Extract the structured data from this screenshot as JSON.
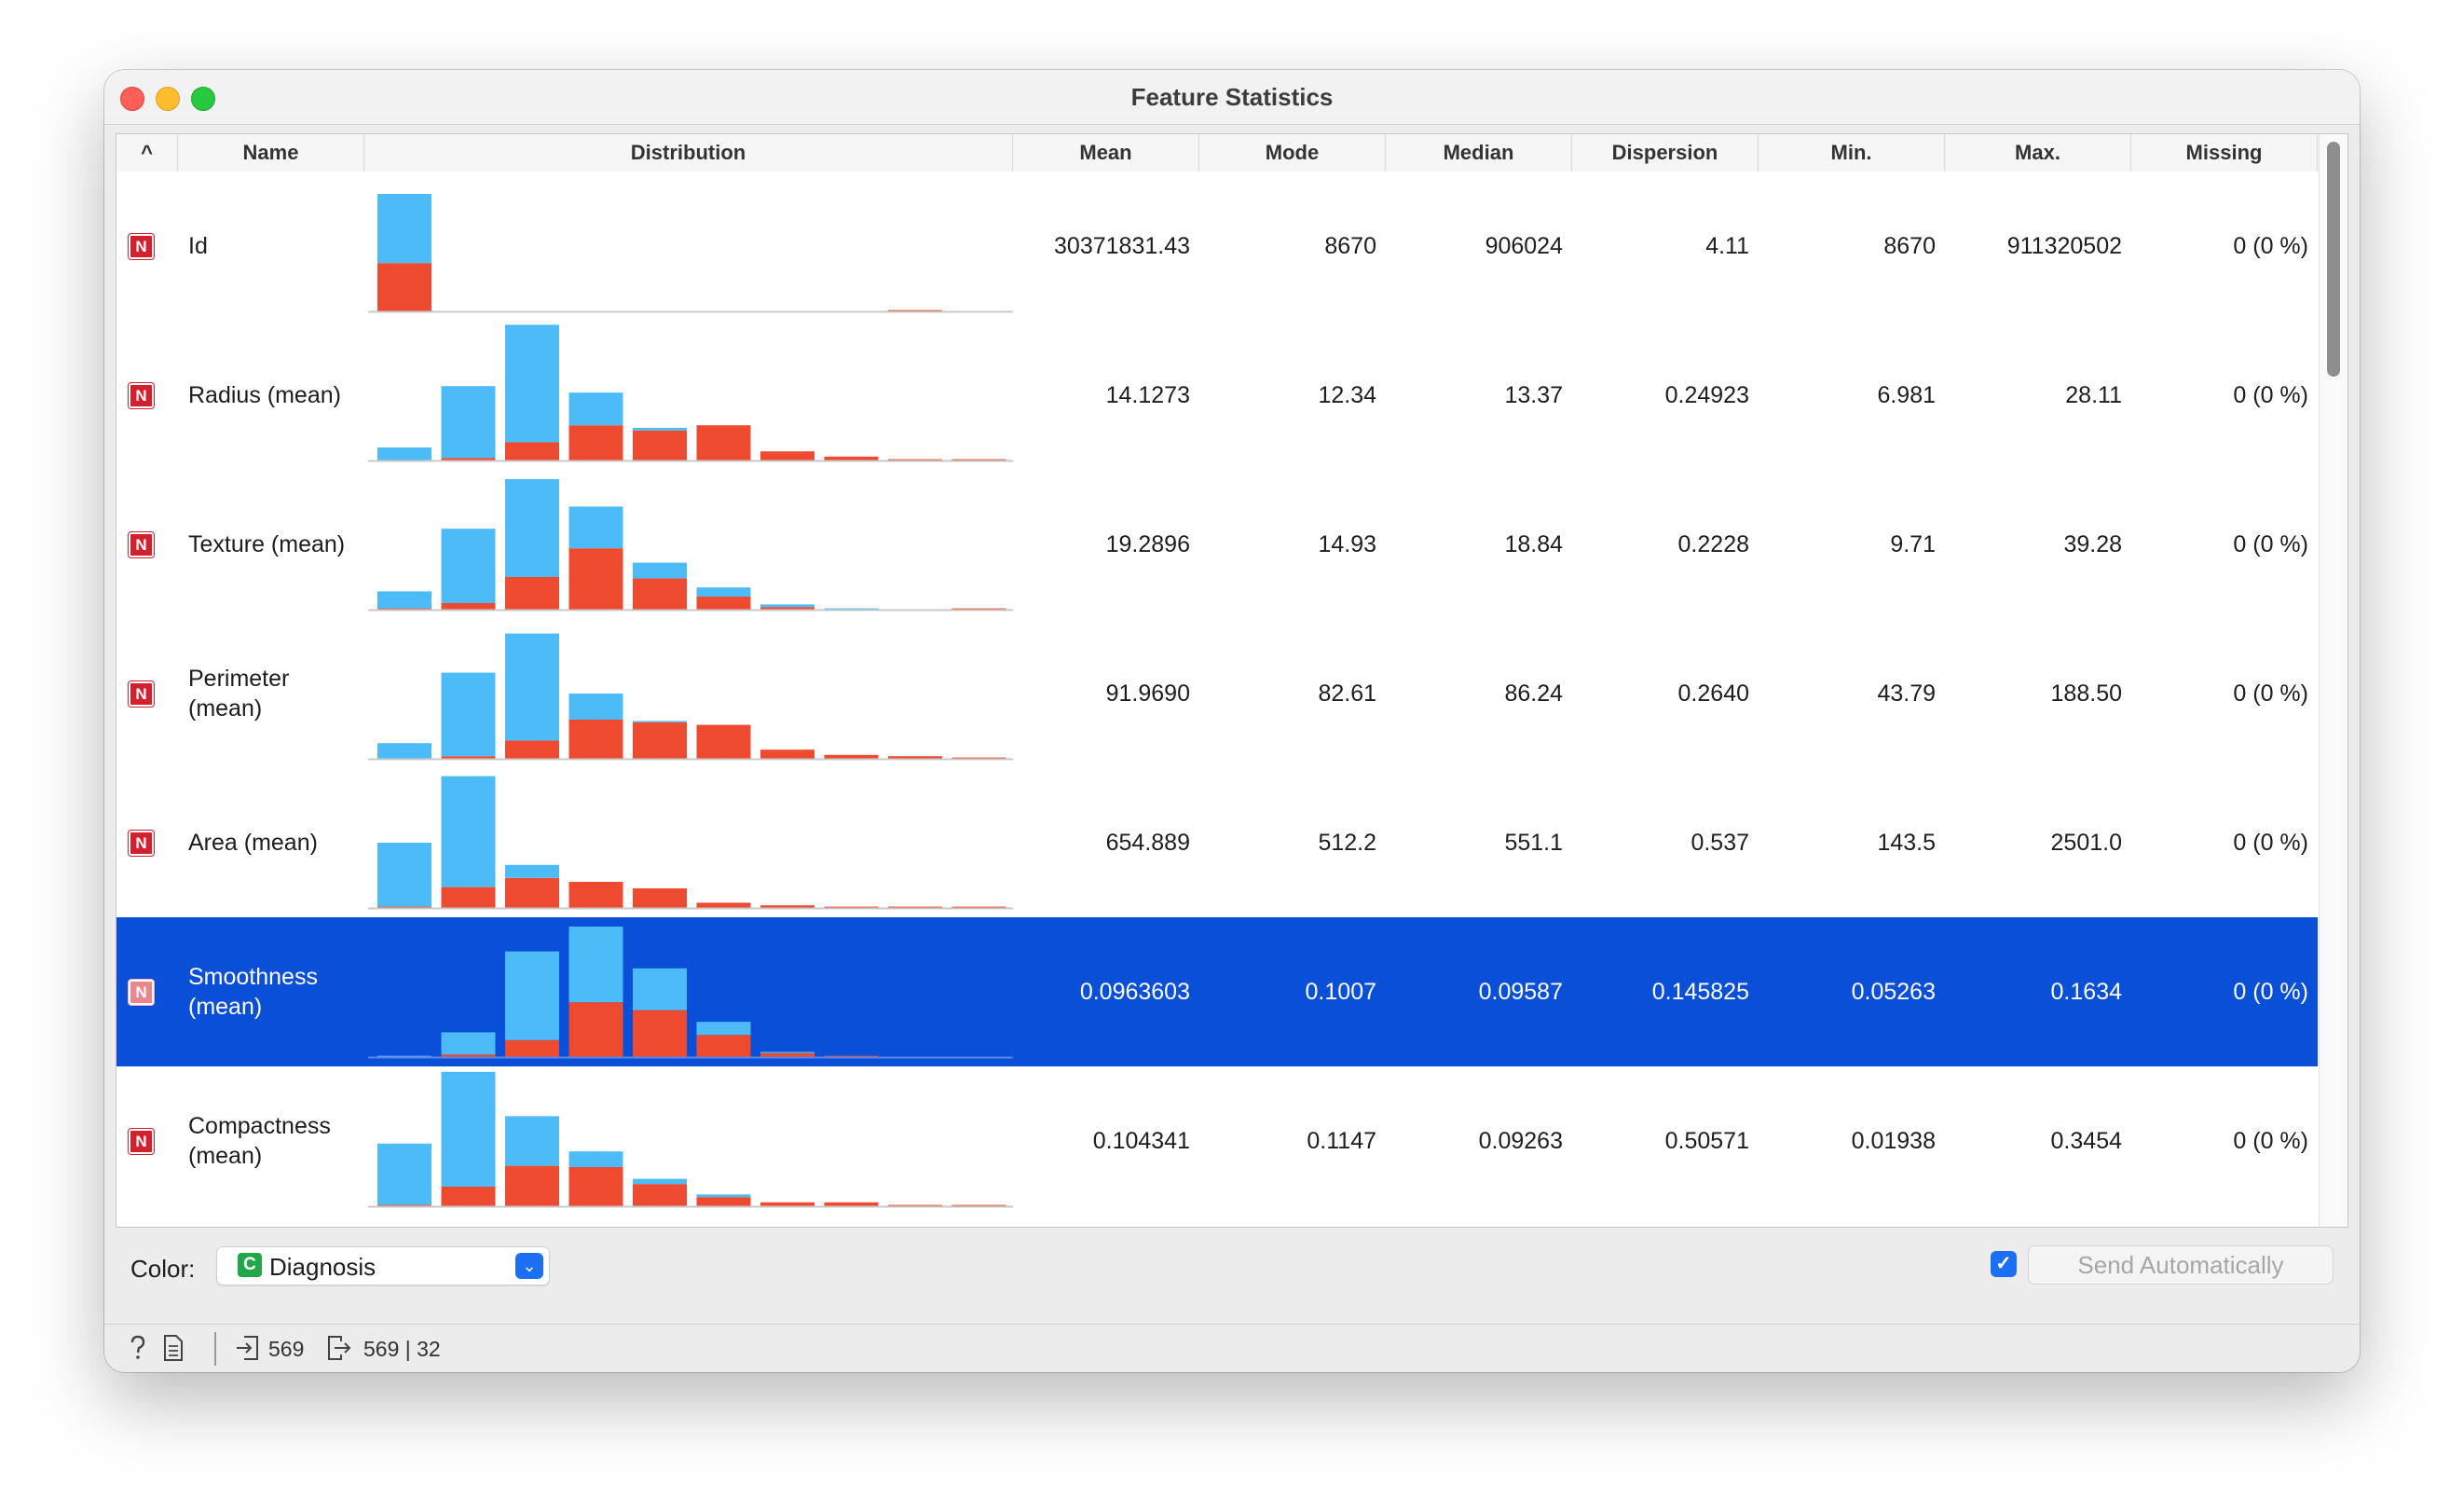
{
  "window": {
    "title": "Feature Statistics"
  },
  "table": {
    "sort_indicator": "^",
    "columns": [
      "Name",
      "Distribution",
      "Mean",
      "Mode",
      "Median",
      "Dispersion",
      "Min.",
      "Max.",
      "Missing"
    ],
    "rows": [
      {
        "type_badge": "N",
        "name": "Id",
        "mean": "30371831.43",
        "mode": "8670",
        "median": "906024",
        "dispersion": "4.11",
        "min": "8670",
        "max": "911320502",
        "missing": "0 (0 %)",
        "histogram": {
          "blue": [
            0.53,
            0,
            0,
            0,
            0,
            0,
            0,
            0,
            0,
            0
          ],
          "red": [
            0.37,
            0,
            0,
            0,
            0,
            0,
            0,
            0,
            0.01,
            0
          ]
        }
      },
      {
        "type_badge": "N",
        "name": "Radius (mean)",
        "mean": "14.1273",
        "mode": "12.34",
        "median": "13.37",
        "dispersion": "0.24923",
        "min": "6.981",
        "max": "28.11",
        "missing": "0 (0 %)",
        "histogram": {
          "blue": [
            0.1,
            0.55,
            0.9,
            0.25,
            0.02,
            0,
            0,
            0,
            0,
            0
          ],
          "red": [
            0,
            0.02,
            0.14,
            0.27,
            0.23,
            0.27,
            0.07,
            0.03,
            0.01,
            0.01
          ]
        }
      },
      {
        "type_badge": "N",
        "name": "Texture (mean)",
        "mean": "19.2896",
        "mode": "14.93",
        "median": "18.84",
        "dispersion": "0.2228",
        "min": "9.71",
        "max": "39.28",
        "missing": "0 (0 %)",
        "histogram": {
          "blue": [
            0.13,
            0.57,
            0.75,
            0.32,
            0.12,
            0.07,
            0.02,
            0.01,
            0,
            0
          ],
          "red": [
            0.01,
            0.05,
            0.25,
            0.47,
            0.24,
            0.1,
            0.02,
            0,
            0,
            0.01
          ]
        }
      },
      {
        "type_badge": "N",
        "name": "Perimeter (mean)",
        "mean": "91.9690",
        "mode": "82.61",
        "median": "86.24",
        "dispersion": "0.2640",
        "min": "43.79",
        "max": "188.50",
        "missing": "0 (0 %)",
        "histogram": {
          "blue": [
            0.12,
            0.64,
            0.82,
            0.2,
            0.01,
            0,
            0,
            0,
            0,
            0
          ],
          "red": [
            0,
            0.02,
            0.14,
            0.3,
            0.28,
            0.26,
            0.07,
            0.03,
            0.02,
            0.01
          ]
        }
      },
      {
        "type_badge": "N",
        "name": "Area (mean)",
        "mean": "654.889",
        "mode": "512.2",
        "median": "551.1",
        "dispersion": "0.537",
        "min": "143.5",
        "max": "2501.0",
        "missing": "0 (0 %)",
        "histogram": {
          "blue": [
            0.49,
            0.85,
            0.1,
            0,
            0,
            0,
            0,
            0,
            0,
            0
          ],
          "red": [
            0.01,
            0.16,
            0.23,
            0.2,
            0.15,
            0.04,
            0.02,
            0.01,
            0.01,
            0.01
          ]
        }
      },
      {
        "type_badge": "N",
        "name": "Smoothness (mean)",
        "mean": "0.0963603",
        "mode": "0.1007",
        "median": "0.09587",
        "dispersion": "0.145825",
        "min": "0.05263",
        "max": "0.1634",
        "missing": "0 (0 %)",
        "selected": true,
        "histogram": {
          "blue": [
            0.01,
            0.17,
            0.68,
            0.58,
            0.32,
            0.1,
            0.01,
            0,
            0,
            0
          ],
          "red": [
            0,
            0.02,
            0.13,
            0.42,
            0.36,
            0.17,
            0.03,
            0.01,
            0,
            0
          ]
        }
      },
      {
        "type_badge": "N",
        "name": "Compactness (mean)",
        "mean": "0.104341",
        "mode": "0.1147",
        "median": "0.09263",
        "dispersion": "0.50571",
        "min": "0.01938",
        "max": "0.3454",
        "missing": "0 (0 %)",
        "histogram": {
          "blue": [
            0.47,
            0.88,
            0.38,
            0.12,
            0.04,
            0.02,
            0,
            0,
            0,
            0
          ],
          "red": [
            0.01,
            0.15,
            0.31,
            0.3,
            0.17,
            0.07,
            0.03,
            0.03,
            0.01,
            0.01
          ]
        }
      }
    ]
  },
  "controls": {
    "color_label": "Color:",
    "color_value": "Diagnosis",
    "color_value_icon": "C",
    "auto_send_checked": true,
    "send_button": "Send Automatically"
  },
  "status": {
    "input_count": "569",
    "output_count": "569 | 32"
  },
  "colors": {
    "selection": "#0a4fd8",
    "bar_blue": "#4dbbf8",
    "bar_red": "#ee4a30",
    "numeric_badge": "#d2202e"
  }
}
